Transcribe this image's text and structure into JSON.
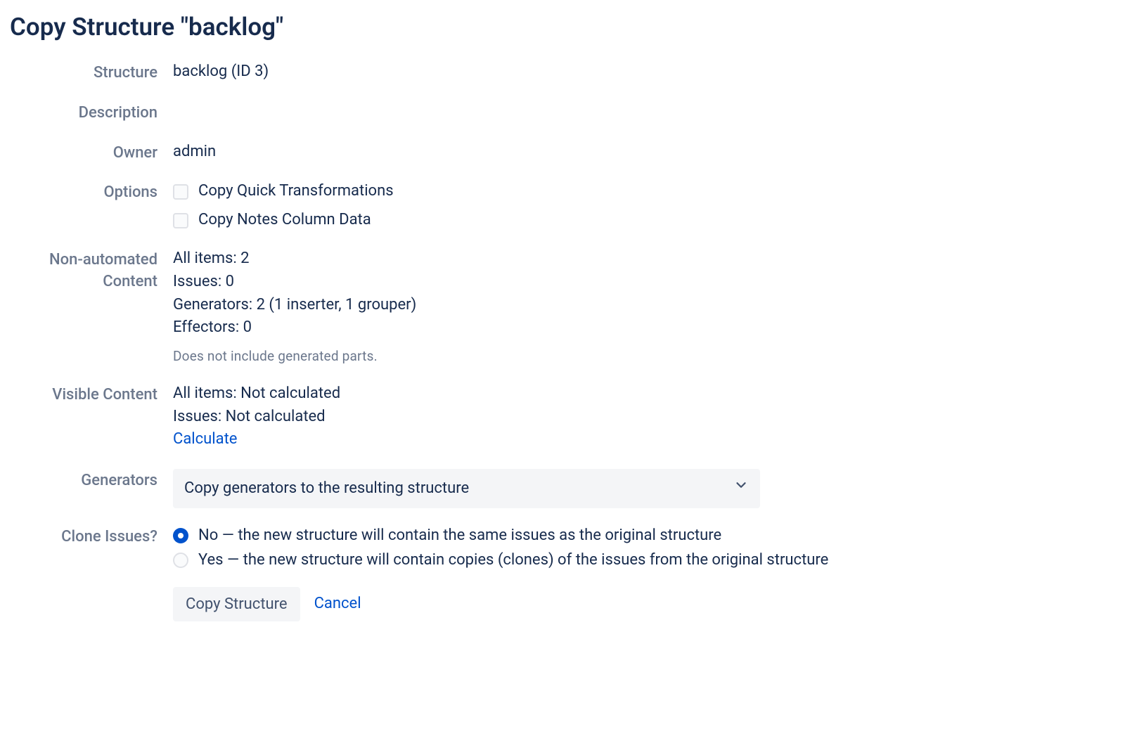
{
  "page_title": "Copy Structure \"backlog\"",
  "labels": {
    "structure": "Structure",
    "description": "Description",
    "owner": "Owner",
    "options": "Options",
    "non_automated_content": "Non-automated Content",
    "visible_content": "Visible Content",
    "generators": "Generators",
    "clone_issues": "Clone Issues?"
  },
  "structure": {
    "value": "backlog (ID 3)"
  },
  "description": {
    "value": ""
  },
  "owner": {
    "value": "admin"
  },
  "options": {
    "copy_quick_transformations": "Copy Quick Transformations",
    "copy_notes_column_data": "Copy Notes Column Data"
  },
  "non_automated_content": {
    "all_items": "All items: 2",
    "issues": "Issues: 0",
    "generators": "Generators: 2 (1 inserter, 1 grouper)",
    "effectors": "Effectors: 0",
    "hint": "Does not include generated parts."
  },
  "visible_content": {
    "all_items": "All items: Not calculated",
    "issues": "Issues: Not calculated",
    "calculate_link": "Calculate"
  },
  "generators": {
    "selected": "Copy generators to the resulting structure"
  },
  "clone_issues": {
    "no_option": "No — the new structure will contain the same issues as the original structure",
    "yes_option": "Yes — the new structure will contain copies (clones) of the issues from the original structure"
  },
  "actions": {
    "copy_structure": "Copy Structure",
    "cancel": "Cancel"
  }
}
